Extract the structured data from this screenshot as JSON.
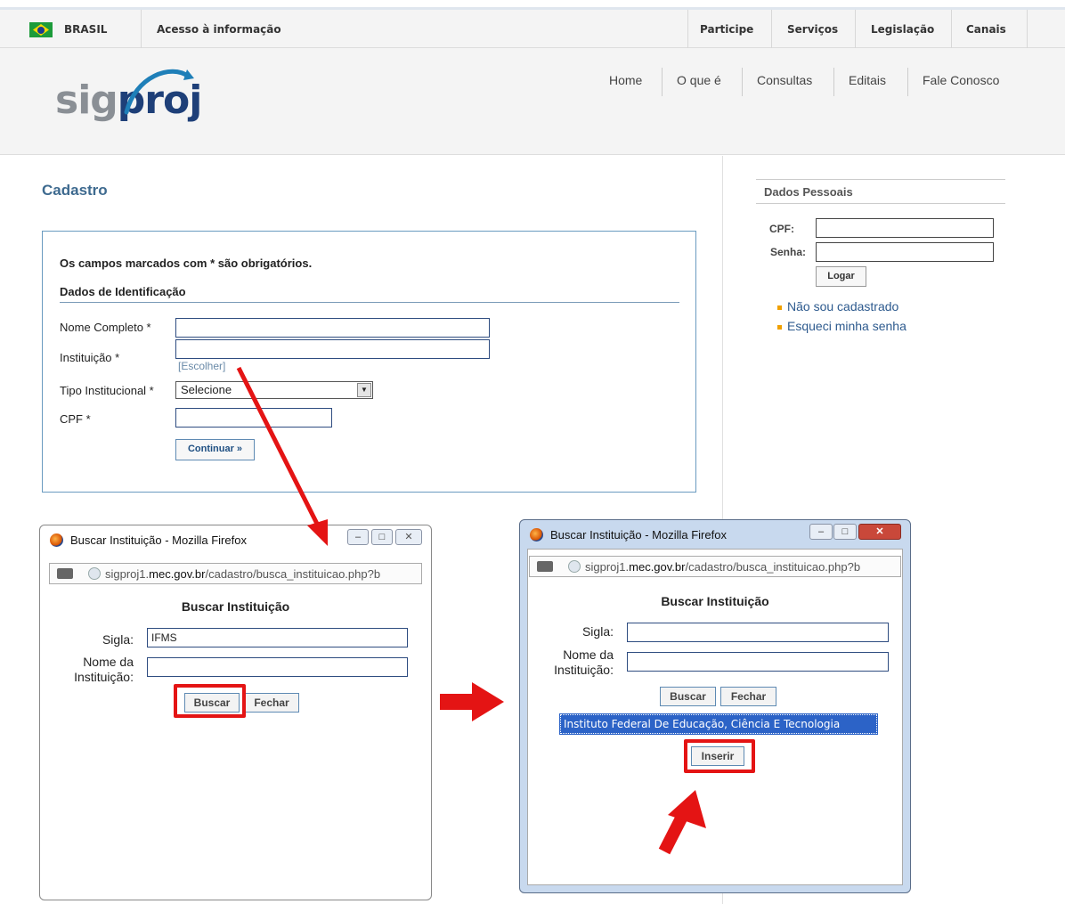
{
  "govbar": {
    "brasil": "BRASIL",
    "acesso": "Acesso à informação",
    "links": [
      "Participe",
      "Serviços",
      "Legislação",
      "Canais"
    ]
  },
  "header": {
    "logo_gray": "sig",
    "logo_blue": "proj",
    "nav": [
      "Home",
      "O que é",
      "Consultas",
      "Editais",
      "Fale Conosco"
    ]
  },
  "main": {
    "title": "Cadastro",
    "notice": "Os campos marcados com * são obrigatórios.",
    "section": "Dados de Identificação",
    "nome_label": "Nome Completo *",
    "instituicao_label": "Instituição *",
    "escolher": "[Escolher]",
    "tipo_label": "Tipo Institucional *",
    "tipo_value": "Selecione",
    "cpf_label": "CPF *",
    "continuar": "Continuar »"
  },
  "side": {
    "title": "Dados Pessoais",
    "cpf_label": "CPF:",
    "senha_label": "Senha:",
    "logar": "Logar",
    "nao_cadastrado": "Não sou cadastrado",
    "esqueci": "Esqueci minha senha"
  },
  "popup1": {
    "title": "Buscar Instituição - Mozilla Firefox",
    "url_host": "sigproj1.",
    "url_domain": "mec.gov.br",
    "url_path": "/cadastro/busca_instituicao.php?b",
    "heading": "Buscar Instituição",
    "sigla_label": "Sigla:",
    "sigla_value": "IFMS",
    "nome_label_1": "Nome da",
    "nome_label_2": "Instituição:",
    "buscar": "Buscar",
    "fechar": "Fechar"
  },
  "popup2": {
    "title": "Buscar Instituição - Mozilla Firefox",
    "url_host": "sigproj1.",
    "url_domain": "mec.gov.br",
    "url_path": "/cadastro/busca_instituicao.php?b",
    "heading": "Buscar Instituição",
    "sigla_label": "Sigla:",
    "nome_label_1": "Nome da",
    "nome_label_2": "Instituição:",
    "buscar": "Buscar",
    "fechar": "Fechar",
    "result": "Instituto Federal De Educação, Ciência E Tecnologia",
    "inserir": "Inserir"
  },
  "colors": {
    "accent": "#3e6a8f",
    "annotation": "#e41414",
    "selection": "#2c63c7"
  }
}
